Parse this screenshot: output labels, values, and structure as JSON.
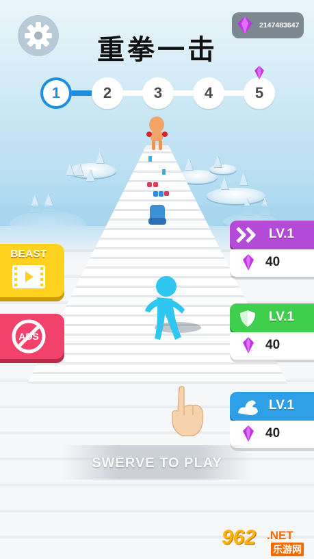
{
  "game": {
    "title": "重拳一击",
    "gem_count": "2147483647",
    "instruction": "SWERVE TO PLAY"
  },
  "level_progress": {
    "levels": [
      "1",
      "2",
      "3",
      "4",
      "5"
    ],
    "current": 1
  },
  "left_buttons": {
    "beast_label": "BEAST",
    "ads_label": "ADS"
  },
  "upgrades": [
    {
      "name": "speed",
      "level": "LV.1",
      "cost": "40",
      "icon": "double-chevron-icon"
    },
    {
      "name": "shield",
      "level": "LV.1",
      "cost": "40",
      "icon": "shield-icon"
    },
    {
      "name": "power",
      "level": "LV.1",
      "cost": "40",
      "icon": "flexed-arm-icon"
    }
  ],
  "watermark": {
    "number": "962",
    "suffix": ".NET",
    "chinese": "乐游网"
  },
  "colors": {
    "gem": "#c035e0",
    "speed": "#b44bd8",
    "shield": "#3fcf4c",
    "power": "#2fa0e8",
    "beast": "#ffd21f",
    "ads": "#f0426a",
    "player": "#2fc6f0",
    "enemy": "#f0a062"
  }
}
